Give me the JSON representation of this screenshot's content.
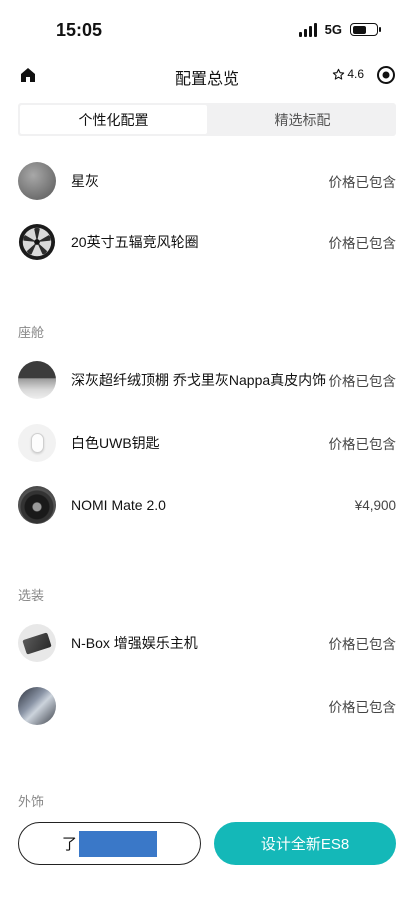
{
  "status_bar": {
    "time": "15:05",
    "network": "5G",
    "battery_level": 0.6,
    "signal_icon": "signal-icon",
    "battery_icon": "battery-icon"
  },
  "nav": {
    "title": "配置总览",
    "rating": "4.6",
    "home_icon": "home-icon",
    "star_icon": "star-outline-icon",
    "record_icon": "record-icon"
  },
  "tabs": [
    {
      "label": "个性化配置",
      "active": true
    },
    {
      "label": "精选标配",
      "active": false
    }
  ],
  "personal_items": [
    {
      "name": "星灰",
      "price": "价格已包含",
      "icon": "paint-swatch-thumbnail"
    },
    {
      "name": "20英寸五辐竞风轮圈",
      "price": "价格已包含",
      "icon": "wheel-thumbnail"
    }
  ],
  "cabin": {
    "title": "座舱",
    "items": [
      {
        "name": "深灰超纤绒顶棚 乔戈里灰Nappa真皮内饰",
        "price": "价格已包含",
        "icon": "interior-thumbnail"
      },
      {
        "name": "白色UWB钥匙",
        "price": "价格已包含",
        "icon": "key-thumbnail"
      },
      {
        "name": "NOMI Mate 2.0",
        "price": "¥4,900",
        "icon": "nomi-thumbnail"
      }
    ]
  },
  "options": {
    "title": "选装",
    "items": [
      {
        "name": "N-Box 增强娱乐主机",
        "price": "价格已包含",
        "icon": "nbox-thumbnail"
      },
      {
        "name": "",
        "price": "价格已包含",
        "icon": "accessory-thumbnail"
      }
    ]
  },
  "exterior": {
    "title": "外饰"
  },
  "bottom": {
    "left_button": "了",
    "right_button": "设计全新ES8"
  },
  "colors": {
    "accent": "#14b8b8",
    "tab_background": "#f1f1f2",
    "section_title": "#888888"
  }
}
